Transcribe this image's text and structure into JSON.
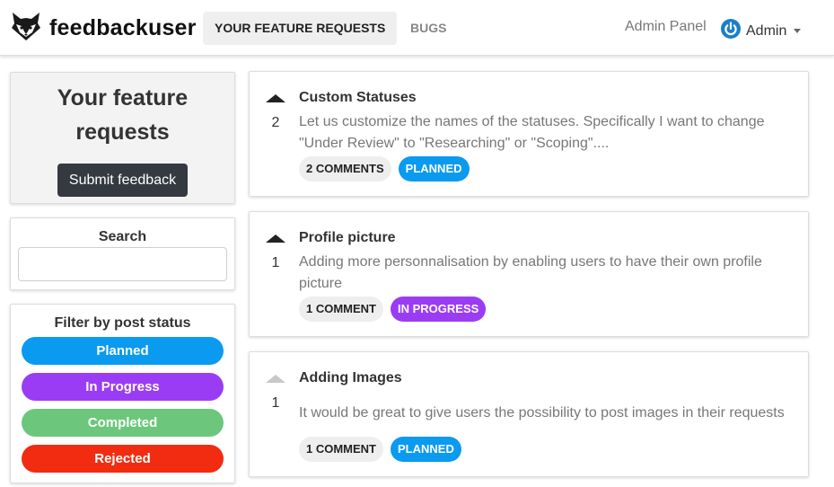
{
  "header": {
    "brand": "feedbackuser",
    "tabs": [
      {
        "label": "YOUR FEATURE REQUESTS",
        "active": true
      },
      {
        "label": "BUGS",
        "active": false
      }
    ],
    "admin_panel": "Admin Panel",
    "user": "Admin"
  },
  "sidebar": {
    "intro_title": "Your feature requests",
    "submit_label": "Submit feedback",
    "search_label": "Search",
    "search_value": "",
    "filter_label": "Filter by post status",
    "filters": [
      {
        "label": "Planned",
        "color": "#0a9af0"
      },
      {
        "label": "In Progress",
        "color": "#9b3cf5"
      },
      {
        "label": "Completed",
        "color": "#6cc77c"
      },
      {
        "label": "Rejected",
        "color": "#f22c11"
      }
    ]
  },
  "posts": [
    {
      "title": "Custom Statuses",
      "votes": "2",
      "voted": true,
      "description": "Let us customize the names of the statuses. Specifically I want to change \"Under Review\" to \"Researching\" or \"Scoping\"....",
      "comments": "2 COMMENTS",
      "status": "PLANNED",
      "status_color": "#0a9af0"
    },
    {
      "title": "Profile picture",
      "votes": "1",
      "voted": true,
      "description": "Adding more personnalisation by enabling users to have their own profile picture",
      "comments": "1 COMMENT",
      "status": "IN PROGRESS",
      "status_color": "#9b3cf5"
    },
    {
      "title": "Adding Images",
      "votes": "1",
      "voted": false,
      "description": "It would be great to give users the possibility to post images in their requests",
      "comments": "1 COMMENT",
      "status": "PLANNED",
      "status_color": "#0a9af0"
    }
  ],
  "icons": {
    "brand": "fox-logo-icon",
    "user": "power-icon",
    "user_icon_color": "#1a7fc9",
    "vote": "upvote-arrow-icon"
  }
}
